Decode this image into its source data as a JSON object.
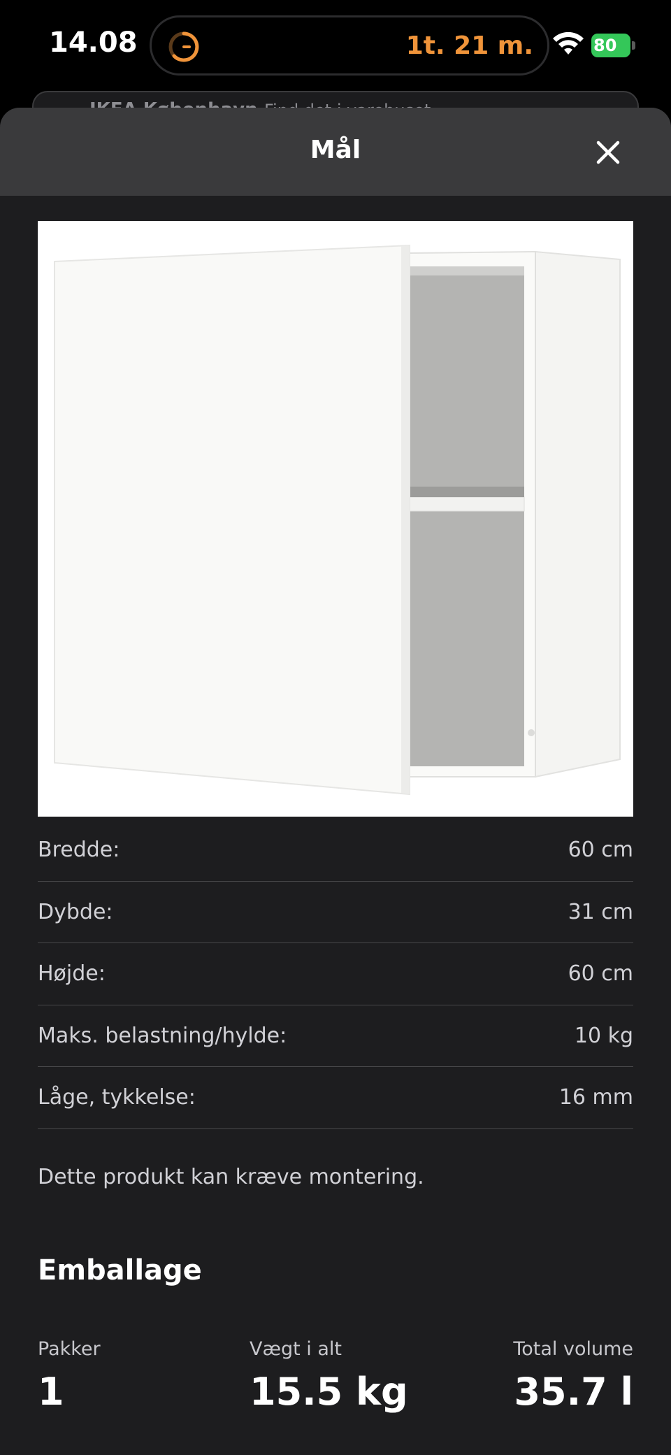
{
  "status_bar": {
    "time": "14.08",
    "timer": "1t. 21 m.",
    "battery": "80"
  },
  "background_page": {
    "store": "IKEA København",
    "find": "Find det i varehuset"
  },
  "sheet": {
    "title": "Mål",
    "close_icon": "close-icon",
    "image_alt": "white wall cabinet with door and shelf",
    "dimensions": [
      {
        "label": "Bredde:",
        "value": "60 cm"
      },
      {
        "label": "Dybde:",
        "value": "31 cm"
      },
      {
        "label": "Højde:",
        "value": "60 cm"
      },
      {
        "label": "Maks. belastning/hylde:",
        "value": "10 kg"
      },
      {
        "label": "Låge, tykkelse:",
        "value": "16 mm"
      }
    ],
    "assembly_note": "Dette produkt kan kræve montering.",
    "packaging": {
      "heading": "Emballage",
      "packages_label": "Pakker",
      "packages_value": "1",
      "weight_label": "Vægt i alt",
      "weight_value": "15.5 kg",
      "volume_label": "Total volume",
      "volume_value": "35.7 l"
    }
  },
  "colors": {
    "accent_timer": "#f0943a",
    "battery": "#34c759",
    "sheet_bg": "#1d1d1f",
    "header_bg": "#3a3a3c"
  }
}
